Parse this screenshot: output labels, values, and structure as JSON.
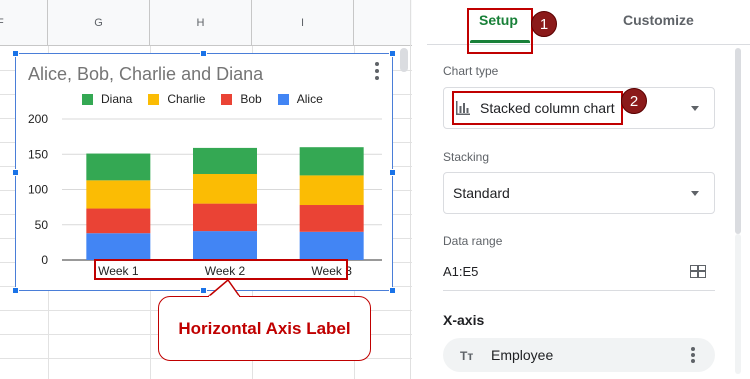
{
  "sheet": {
    "column_headers": [
      "F",
      "G",
      "H",
      "I"
    ]
  },
  "chart": {
    "menu_icon": "more-vert-icon"
  },
  "chart_data": {
    "type": "bar",
    "stacked": true,
    "title": "Alice, Bob, Charlie and Diana",
    "categories": [
      "Week 1",
      "Week 2",
      "Week 3"
    ],
    "series": [
      {
        "name": "Alice",
        "color": "#4285f4",
        "values": [
          38,
          41,
          40
        ]
      },
      {
        "name": "Bob",
        "color": "#ea4335",
        "values": [
          35,
          39,
          38
        ]
      },
      {
        "name": "Charlie",
        "color": "#fbbc04",
        "values": [
          40,
          42,
          42
        ]
      },
      {
        "name": "Diana",
        "color": "#34a853",
        "values": [
          38,
          37,
          40
        ]
      }
    ],
    "legend_order": [
      "Diana",
      "Charlie",
      "Bob",
      "Alice"
    ],
    "legend_position": "top",
    "ylim": [
      0,
      200
    ],
    "yticks": [
      "0",
      "50",
      "100",
      "150",
      "200"
    ],
    "grid": true
  },
  "annotation": {
    "bubble_text": "Horizontal Axis Label",
    "accent_color": "#c00000"
  },
  "panel": {
    "tabs": [
      {
        "label": "Setup",
        "active": true
      },
      {
        "label": "Customize",
        "active": false
      }
    ],
    "chart_type_label": "Chart type",
    "chart_type_value": "Stacked column chart",
    "chart_type_icon": "bar-chart-icon",
    "stacking_label": "Stacking",
    "stacking_value": "Standard",
    "data_range_label": "Data range",
    "data_range_value": "A1:E5",
    "data_range_icon": "grid-select-icon",
    "xaxis_title": "X-axis",
    "xaxis_value": "Employee",
    "xaxis_icon": "text-type-icon",
    "xaxis_icon_glyph": "Tт",
    "badges": [
      "1",
      "2"
    ]
  }
}
